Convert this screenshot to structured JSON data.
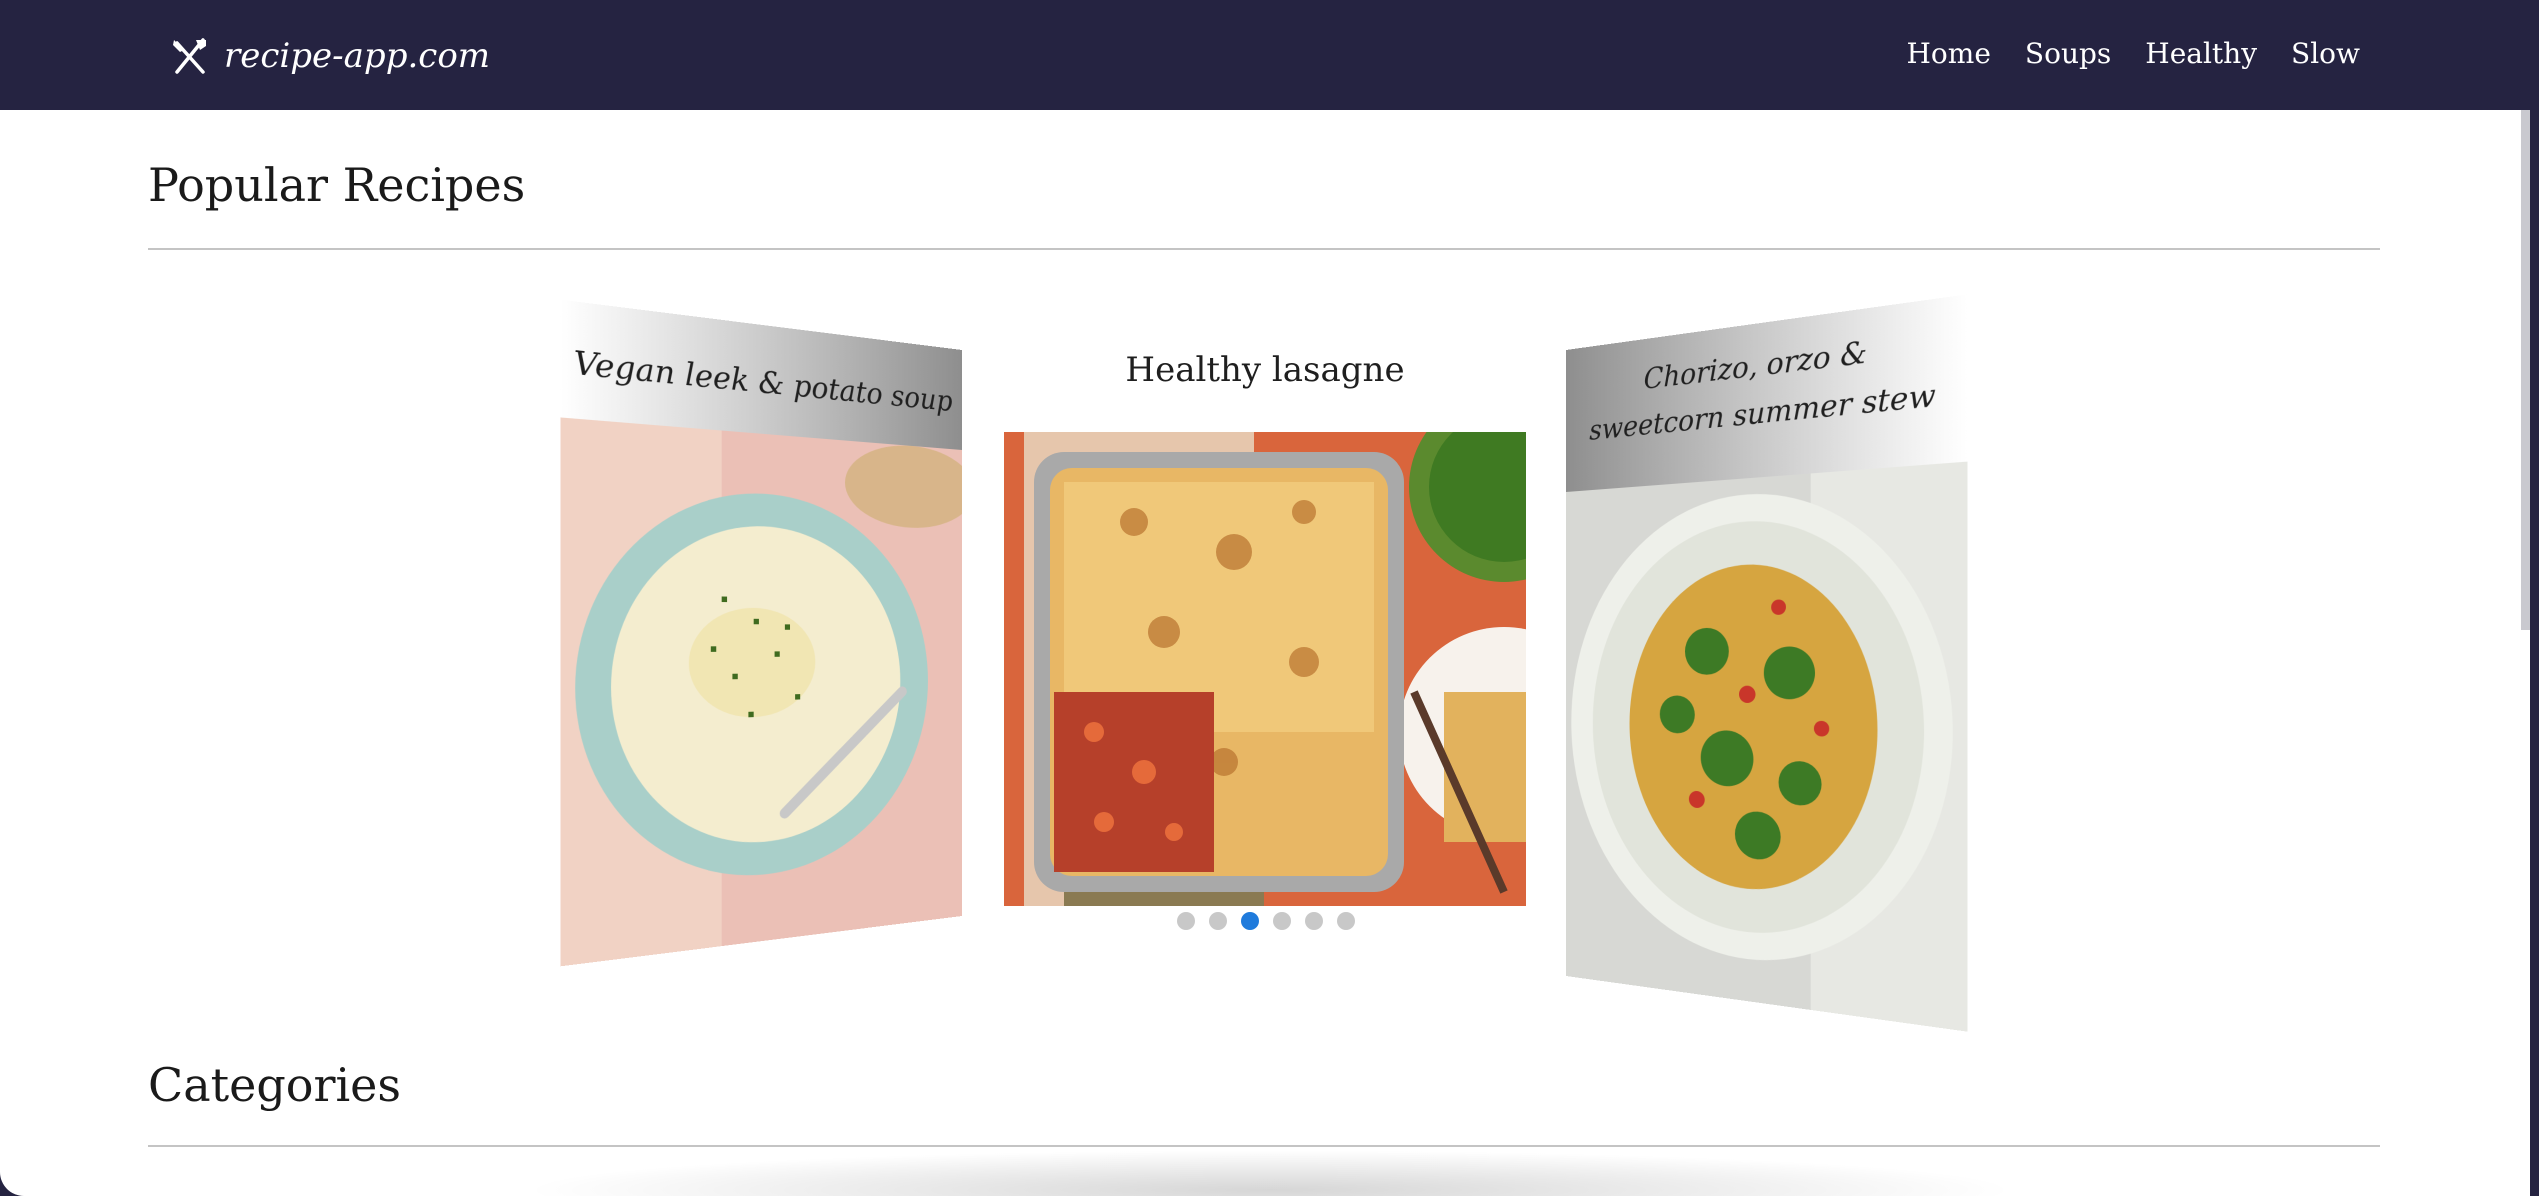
{
  "navbar": {
    "brand": "recipe-app.com",
    "brand_icon": "utensils-crossed-icon",
    "links": [
      "Home",
      "Soups",
      "Healthy",
      "Slow"
    ]
  },
  "sections": {
    "popular_title": "Popular Recipes",
    "categories_title": "Categories"
  },
  "carousel": {
    "slides": [
      {
        "title": "Vegan leek & potato soup",
        "image": "leek-potato-soup-image"
      },
      {
        "title": "Healthy lasagne",
        "image": "lasagne-image"
      },
      {
        "title": "Chorizo, orzo & sweetcorn summer stew",
        "image": "chorizo-orzo-stew-image"
      }
    ],
    "dot_count": 6,
    "active_dot": 3
  },
  "colors": {
    "navbar_bg": "#252341",
    "dot_active": "#1f7bdc",
    "dot_inactive": "#c8c8c8"
  }
}
